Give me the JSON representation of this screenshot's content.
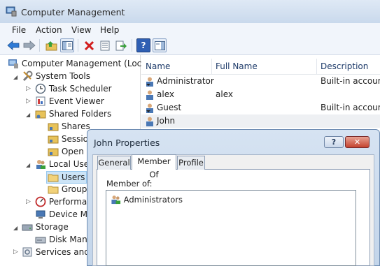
{
  "window": {
    "title": "Computer Management"
  },
  "menu": [
    "File",
    "Action",
    "View",
    "Help"
  ],
  "toolbar": {
    "icons": [
      "back-icon",
      "forward-icon",
      "up-folder-icon",
      "show-hide-tree-icon",
      "delete-icon",
      "properties-icon",
      "export-icon",
      "help-icon",
      "show-hide-action-pane-icon"
    ]
  },
  "tree": {
    "root": "Computer Management (Local",
    "system_tools": "System Tools",
    "task_scheduler": "Task Scheduler",
    "event_viewer": "Event Viewer",
    "shared_folders": "Shared Folders",
    "shares": "Shares",
    "sessions": "Sessio",
    "open_files": "Open",
    "local_users": "Local User",
    "users": "Users",
    "groups": "Group",
    "performance": "Performan",
    "device_manager": "Device Ma",
    "storage": "Storage",
    "disk_management": "Disk Mana",
    "services": "Services and A"
  },
  "list": {
    "columns": [
      "Name",
      "Full Name",
      "Description"
    ],
    "rows": [
      {
        "name": "Administrator",
        "full_name": "",
        "description": "Built-in account"
      },
      {
        "name": "alex",
        "full_name": "alex",
        "description": ""
      },
      {
        "name": "Guest",
        "full_name": "",
        "description": "Built-in account"
      },
      {
        "name": "John",
        "full_name": "",
        "description": ""
      }
    ]
  },
  "dialog": {
    "title": "John Properties",
    "help_glyph": "?",
    "close_glyph": "✕",
    "tabs": [
      "General",
      "Member Of",
      "Profile"
    ],
    "selected_tab": "Member Of",
    "member_of_label": "Member of:",
    "members": [
      "Administrators"
    ]
  },
  "colors": {
    "selection": "#cce4f7",
    "title_gradient_top": "#dfe9f5",
    "close_red": "#c4432f"
  }
}
